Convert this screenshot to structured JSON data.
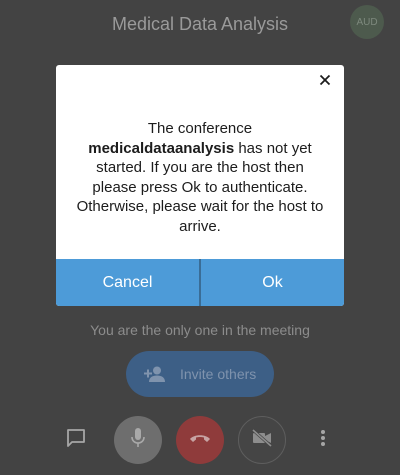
{
  "header": {
    "title": "Medical Data Analysis",
    "avatar_initials": "AUD"
  },
  "meeting": {
    "alone_text": "You are the only one in the meeting",
    "invite_label": "Invite others"
  },
  "toolbar": {
    "icons": [
      "chat-icon",
      "microphone-icon",
      "hang-up-icon",
      "video-off-icon",
      "more-vertical-icon"
    ]
  },
  "dialog": {
    "message_before": "The conference ",
    "conference_name": "medicaldataanalysis",
    "message_after": " has not yet started. If you are the host then please press Ok to authenticate. Otherwise, please wait for the host to arrive.",
    "cancel_label": "Cancel",
    "ok_label": "Ok",
    "close_icon": "close-icon"
  },
  "colors": {
    "overlay_background": "#434343",
    "dialog_button": "#4d9bd8",
    "hangup": "#8f3b3b",
    "invite_button": "#3d5f86"
  }
}
